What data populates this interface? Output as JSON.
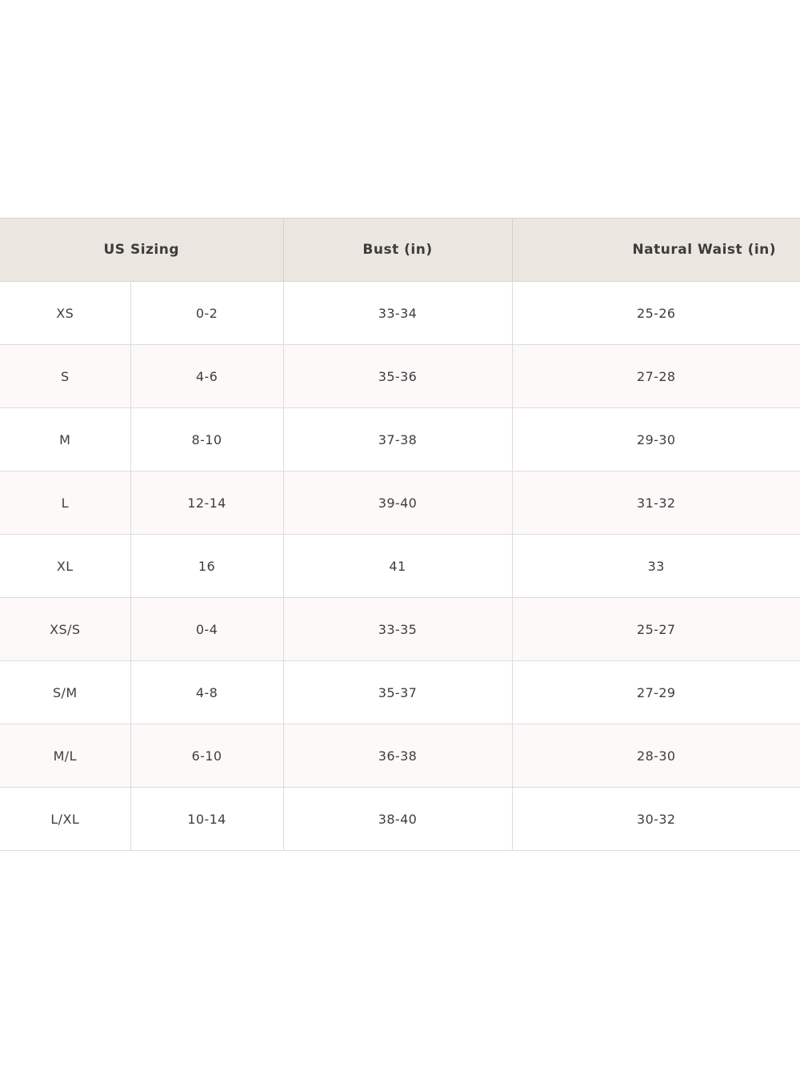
{
  "table": {
    "headers": {
      "us_sizing": "US Sizing",
      "bust": "Bust (in)",
      "natural_waist": "Natural Waist (in)"
    },
    "rows": [
      {
        "size": "XS",
        "us": "0-2",
        "bust": "33-34",
        "waist": "25-26"
      },
      {
        "size": "S",
        "us": "4-6",
        "bust": "35-36",
        "waist": "27-28"
      },
      {
        "size": "M",
        "us": "8-10",
        "bust": "37-38",
        "waist": "29-30"
      },
      {
        "size": "L",
        "us": "12-14",
        "bust": "39-40",
        "waist": "31-32"
      },
      {
        "size": "XL",
        "us": "16",
        "bust": "41",
        "waist": "33"
      },
      {
        "size": "XS/S",
        "us": "0-4",
        "bust": "33-35",
        "waist": "25-27"
      },
      {
        "size": "S/M",
        "us": "4-8",
        "bust": "35-37",
        "waist": "27-29"
      },
      {
        "size": "M/L",
        "us": "6-10",
        "bust": "36-38",
        "waist": "28-30"
      },
      {
        "size": "L/XL",
        "us": "10-14",
        "bust": "38-40",
        "waist": "30-32"
      }
    ]
  },
  "colors": {
    "header_background": "#ebe6e0",
    "stripe_background": "#fdf9f8",
    "border": "#dcdcdc",
    "text": "#3e3e3e"
  }
}
